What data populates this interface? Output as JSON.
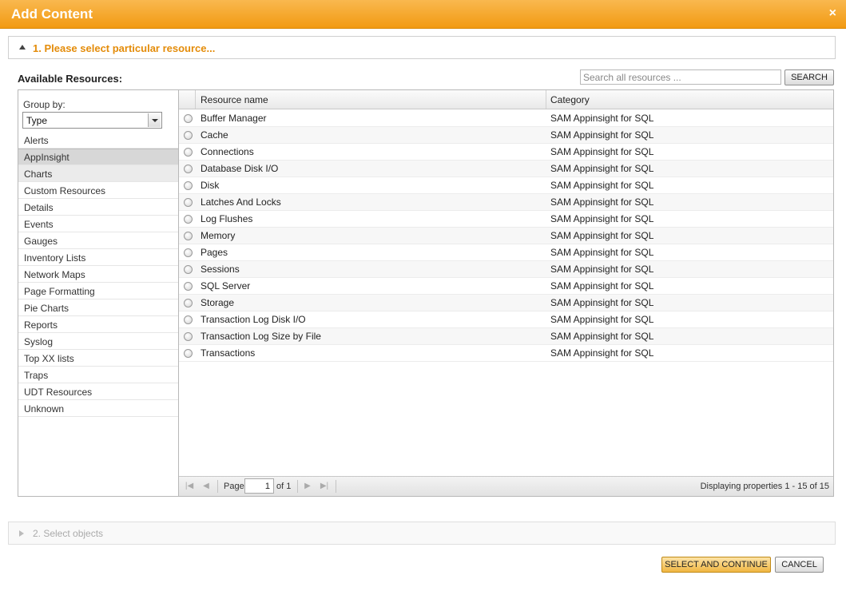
{
  "dialog": {
    "title": "Add Content",
    "close_label": "×"
  },
  "step1": {
    "label": "1. Please select particular resource..."
  },
  "available_label": "Available Resources:",
  "search": {
    "placeholder": "Search all resources ...",
    "value": "",
    "button_label": "SEARCH"
  },
  "group_by": {
    "label": "Group by:",
    "selected": "Type",
    "items": [
      {
        "label": "Alerts",
        "state": "normal"
      },
      {
        "label": "AppInsight",
        "state": "selected"
      },
      {
        "label": "Charts",
        "state": "alt"
      },
      {
        "label": "Custom Resources",
        "state": "normal"
      },
      {
        "label": "Details",
        "state": "normal"
      },
      {
        "label": "Events",
        "state": "normal"
      },
      {
        "label": "Gauges",
        "state": "normal"
      },
      {
        "label": "Inventory Lists",
        "state": "normal"
      },
      {
        "label": "Network Maps",
        "state": "normal"
      },
      {
        "label": "Page Formatting",
        "state": "normal"
      },
      {
        "label": "Pie Charts",
        "state": "normal"
      },
      {
        "label": "Reports",
        "state": "normal"
      },
      {
        "label": "Syslog",
        "state": "normal"
      },
      {
        "label": "Top XX lists",
        "state": "normal"
      },
      {
        "label": "Traps",
        "state": "normal"
      },
      {
        "label": "UDT Resources",
        "state": "normal"
      },
      {
        "label": "Unknown",
        "state": "normal"
      }
    ]
  },
  "grid": {
    "columns": {
      "name": "Resource name",
      "category": "Category"
    },
    "rows": [
      {
        "name": "Buffer Manager",
        "category": "SAM Appinsight for SQL"
      },
      {
        "name": "Cache",
        "category": "SAM Appinsight for SQL"
      },
      {
        "name": "Connections",
        "category": "SAM Appinsight for SQL"
      },
      {
        "name": "Database Disk I/O",
        "category": "SAM Appinsight for SQL"
      },
      {
        "name": "Disk",
        "category": "SAM Appinsight for SQL"
      },
      {
        "name": "Latches And Locks",
        "category": "SAM Appinsight for SQL"
      },
      {
        "name": "Log Flushes",
        "category": "SAM Appinsight for SQL"
      },
      {
        "name": "Memory",
        "category": "SAM Appinsight for SQL"
      },
      {
        "name": "Pages",
        "category": "SAM Appinsight for SQL"
      },
      {
        "name": "Sessions",
        "category": "SAM Appinsight for SQL"
      },
      {
        "name": "SQL Server",
        "category": "SAM Appinsight for SQL"
      },
      {
        "name": "Storage",
        "category": "SAM Appinsight for SQL"
      },
      {
        "name": "Transaction Log Disk I/O",
        "category": "SAM Appinsight for SQL"
      },
      {
        "name": "Transaction Log Size by File",
        "category": "SAM Appinsight for SQL"
      },
      {
        "name": "Transactions",
        "category": "SAM Appinsight for SQL"
      }
    ]
  },
  "pager": {
    "page_label": "Page",
    "page_value": "1",
    "of_label": "of 1",
    "display_text": "Displaying properties 1 - 15 of 15",
    "icons": {
      "first": "first-page-icon",
      "prev": "prev-page-icon",
      "next": "next-page-icon",
      "last": "last-page-icon"
    }
  },
  "step2": {
    "label": "2. Select objects"
  },
  "footer": {
    "select_continue_label": "SELECT AND CONTINUE",
    "cancel_label": "CANCEL"
  }
}
